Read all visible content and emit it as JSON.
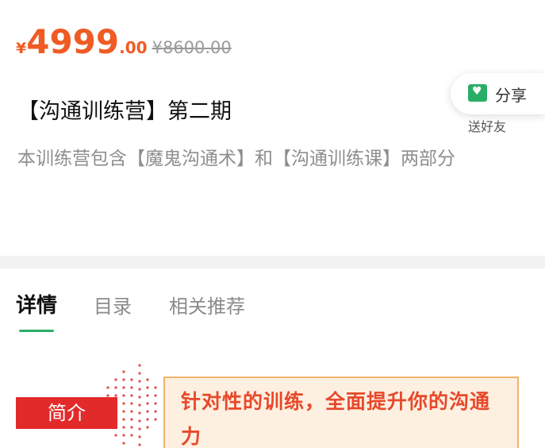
{
  "price": {
    "currency": "¥",
    "integer": "4999",
    "decimal": ".00",
    "original": "¥8600.00"
  },
  "product": {
    "title": "【沟通训练营】第二期",
    "subtitle": "本训练营包含【魔鬼沟通术】和【沟通训练课】两部分"
  },
  "share": {
    "icon": "gift-icon",
    "label": "分享",
    "sub_label": "送好友"
  },
  "tabs": [
    {
      "label": "详情",
      "active": true
    },
    {
      "label": "目录",
      "active": false
    },
    {
      "label": "相关推荐",
      "active": false
    }
  ],
  "intro": {
    "badge": "简介",
    "text": "针对性的训练，全面提升你的沟通力"
  },
  "colors": {
    "price": "#f05b23",
    "accent_green": "#2aae67",
    "badge_red": "#e32a2a",
    "intro_text": "#e8482b",
    "intro_bg": "#fdf0e0",
    "intro_border": "#f0b36b"
  }
}
